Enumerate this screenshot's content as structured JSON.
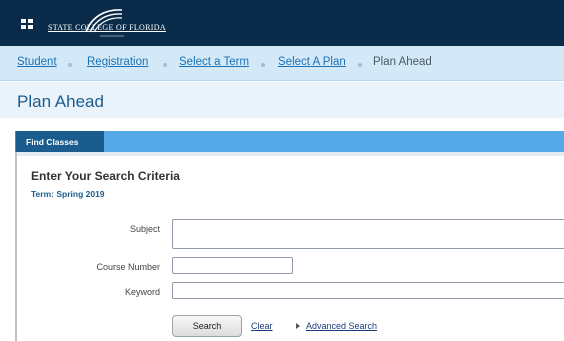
{
  "header": {
    "logo_text": "STATE COLLEGE OF FLORIDA",
    "menu_icon": "grid-menu-icon",
    "background_color": "#0a2c4a"
  },
  "breadcrumb": {
    "items": [
      "Student",
      "Registration",
      "Select a Term",
      "Select A Plan",
      "Plan Ahead"
    ]
  },
  "page_title": "Plan Ahead",
  "tabs": [
    {
      "label": "Find Classes",
      "active": true
    }
  ],
  "search_criteria": {
    "title": "Enter Your Search Criteria",
    "term": "Term: Spring 2019",
    "fields": {
      "subject_label": "Subject",
      "subject_value": "",
      "course_number_label": "Course Number",
      "course_number_value": "",
      "keyword_label": "Keyword",
      "keyword_value": ""
    },
    "search_button": "Search",
    "clear_link": "Clear",
    "advanced_search_link": "Advanced Search"
  },
  "colors": {
    "accent_blue": "#54a8e6",
    "tab_dark": "#1b5c8e",
    "link": "#1b72b5"
  }
}
